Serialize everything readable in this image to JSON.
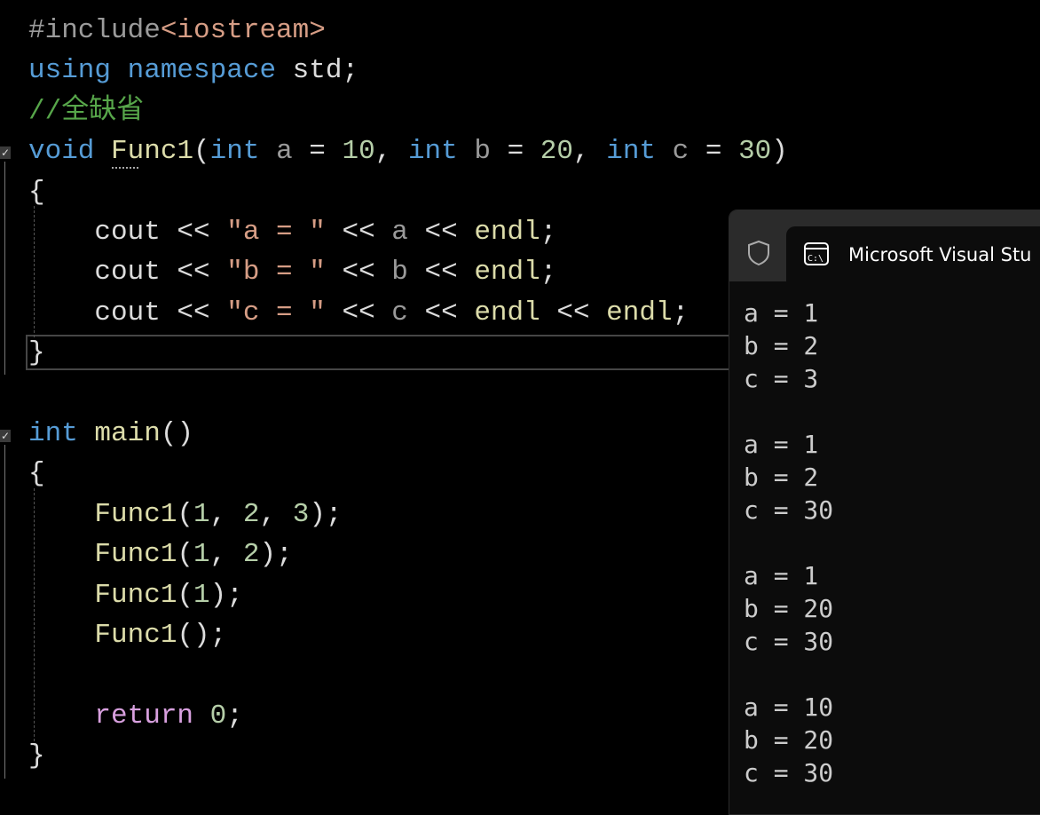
{
  "editor": {
    "lines": [
      [
        [
          "#include",
          "pp"
        ],
        [
          "<iostream>",
          "str"
        ]
      ],
      [
        [
          "using",
          "kw"
        ],
        [
          " ",
          "txt"
        ],
        [
          "namespace",
          "kw"
        ],
        [
          " std;",
          "txt"
        ]
      ],
      [
        [
          "//全缺省",
          "cm"
        ]
      ],
      [
        [
          "void",
          "kw"
        ],
        [
          " ",
          "txt"
        ],
        [
          "Func1",
          "fn"
        ],
        [
          "(",
          "txt"
        ],
        [
          "int",
          "kw"
        ],
        [
          " ",
          "txt"
        ],
        [
          "a",
          "par"
        ],
        [
          " = ",
          "txt"
        ],
        [
          "10",
          "num"
        ],
        [
          ", ",
          "txt"
        ],
        [
          "int",
          "kw"
        ],
        [
          " ",
          "txt"
        ],
        [
          "b",
          "par"
        ],
        [
          " = ",
          "txt"
        ],
        [
          "20",
          "num"
        ],
        [
          ", ",
          "txt"
        ],
        [
          "int",
          "kw"
        ],
        [
          " ",
          "txt"
        ],
        [
          "c",
          "par"
        ],
        [
          " = ",
          "txt"
        ],
        [
          "30",
          "num"
        ],
        [
          ")",
          "txt"
        ]
      ],
      [
        [
          "{",
          "txt"
        ]
      ],
      [
        [
          "    cout << ",
          "txt"
        ],
        [
          "\"a = \"",
          "str"
        ],
        [
          " << ",
          "txt"
        ],
        [
          "a",
          "par"
        ],
        [
          " << ",
          "txt"
        ],
        [
          "endl",
          "fn"
        ],
        [
          ";",
          "txt"
        ]
      ],
      [
        [
          "    cout << ",
          "txt"
        ],
        [
          "\"b = \"",
          "str"
        ],
        [
          " << ",
          "txt"
        ],
        [
          "b",
          "par"
        ],
        [
          " << ",
          "txt"
        ],
        [
          "endl",
          "fn"
        ],
        [
          ";",
          "txt"
        ]
      ],
      [
        [
          "    cout << ",
          "txt"
        ],
        [
          "\"c = \"",
          "str"
        ],
        [
          " << ",
          "txt"
        ],
        [
          "c",
          "par"
        ],
        [
          " << ",
          "txt"
        ],
        [
          "endl",
          "fn"
        ],
        [
          " << ",
          "txt"
        ],
        [
          "endl",
          "fn"
        ],
        [
          ";",
          "txt"
        ]
      ],
      [
        [
          "}",
          "txt"
        ]
      ],
      [],
      [
        [
          "int",
          "kw"
        ],
        [
          " ",
          "txt"
        ],
        [
          "main",
          "fn"
        ],
        [
          "()",
          "txt"
        ]
      ],
      [
        [
          "{",
          "txt"
        ]
      ],
      [
        [
          "    ",
          "txt"
        ],
        [
          "Func1",
          "fn"
        ],
        [
          "(",
          "txt"
        ],
        [
          "1",
          "num"
        ],
        [
          ", ",
          "txt"
        ],
        [
          "2",
          "num"
        ],
        [
          ", ",
          "txt"
        ],
        [
          "3",
          "num"
        ],
        [
          ");",
          "txt"
        ]
      ],
      [
        [
          "    ",
          "txt"
        ],
        [
          "Func1",
          "fn"
        ],
        [
          "(",
          "txt"
        ],
        [
          "1",
          "num"
        ],
        [
          ", ",
          "txt"
        ],
        [
          "2",
          "num"
        ],
        [
          ");",
          "txt"
        ]
      ],
      [
        [
          "    ",
          "txt"
        ],
        [
          "Func1",
          "fn"
        ],
        [
          "(",
          "txt"
        ],
        [
          "1",
          "num"
        ],
        [
          ");",
          "txt"
        ]
      ],
      [
        [
          "    ",
          "txt"
        ],
        [
          "Func1",
          "fn"
        ],
        [
          "();",
          "txt"
        ]
      ],
      [],
      [
        [
          "    ",
          "txt"
        ],
        [
          "return",
          "ret"
        ],
        [
          " ",
          "txt"
        ],
        [
          "0",
          "num"
        ],
        [
          ";",
          "txt"
        ]
      ],
      [
        [
          "}",
          "txt"
        ]
      ]
    ]
  },
  "console": {
    "title": "Microsoft Visual Stu",
    "output": "a = 1\nb = 2\nc = 3\n\na = 1\nb = 2\nc = 30\n\na = 1\nb = 20\nc = 30\n\na = 10\nb = 20\nc = 30"
  }
}
